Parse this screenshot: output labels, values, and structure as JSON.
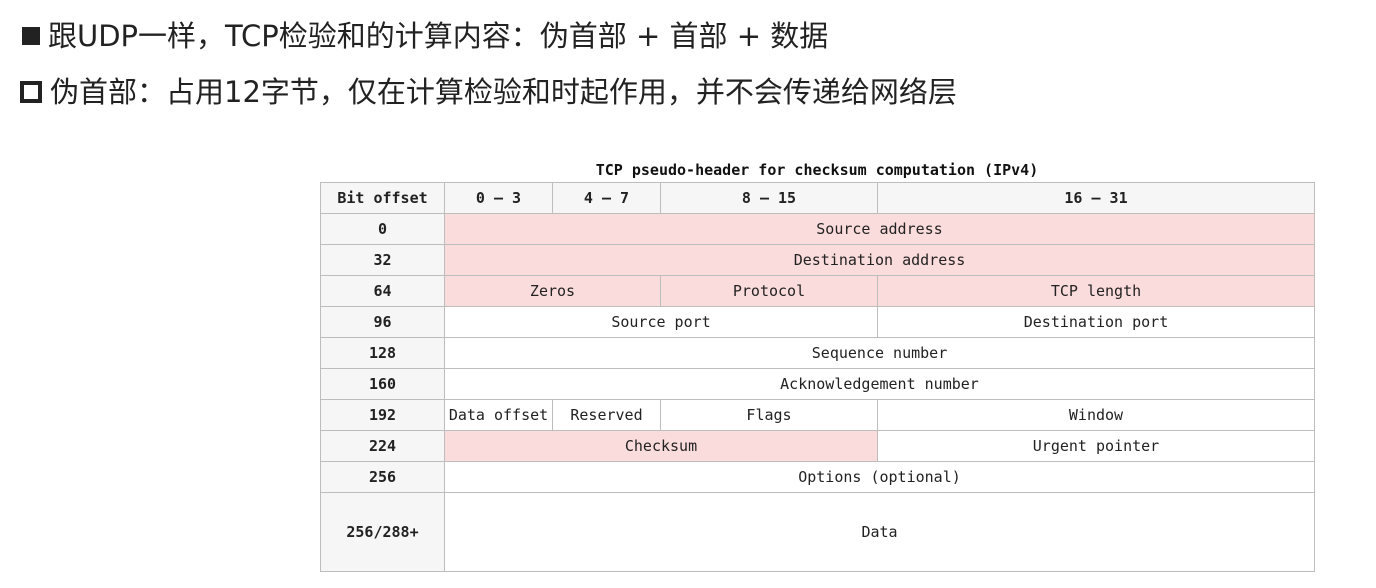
{
  "bullets": [
    {
      "icon": "filled-square-bullet-icon",
      "text": "跟UDP一样，TCP检验和的计算内容：伪首部 + 首部 + 数据"
    },
    {
      "icon": "hollow-square-bullet-icon",
      "text": "伪首部：占用12字节，仅在计算检验和时起作用，并不会传递给网络层"
    }
  ],
  "table": {
    "caption": "TCP pseudo-header for checksum computation (IPv4)",
    "headers": {
      "bit_offset": "Bit offset",
      "c0_3": "0 – 3",
      "c4_7": "4 – 7",
      "c8_15": "8 – 15",
      "c16_31": "16 – 31"
    },
    "rows": {
      "r0": {
        "offset": "0",
        "source_address": "Source address"
      },
      "r32": {
        "offset": "32",
        "destination_address": "Destination address"
      },
      "r64": {
        "offset": "64",
        "zeros": "Zeros",
        "protocol": "Protocol",
        "tcp_length": "TCP length"
      },
      "r96": {
        "offset": "96",
        "source_port": "Source port",
        "destination_port": "Destination port"
      },
      "r128": {
        "offset": "128",
        "sequence_number": "Sequence number"
      },
      "r160": {
        "offset": "160",
        "ack_number": "Acknowledgement number"
      },
      "r192": {
        "offset": "192",
        "data_offset": "Data offset",
        "reserved": "Reserved",
        "flags": "Flags",
        "window": "Window"
      },
      "r224": {
        "offset": "224",
        "checksum": "Checksum",
        "urgent_pointer": "Urgent pointer"
      },
      "r256": {
        "offset": "256",
        "options": "Options (optional)"
      },
      "r288": {
        "offset": "256/288+",
        "data": "Data"
      }
    },
    "colors": {
      "pseudo_header_highlight": "#fbdcdc",
      "offset_column_bg": "#f6f6f6",
      "border": "#bdbdbd"
    }
  }
}
